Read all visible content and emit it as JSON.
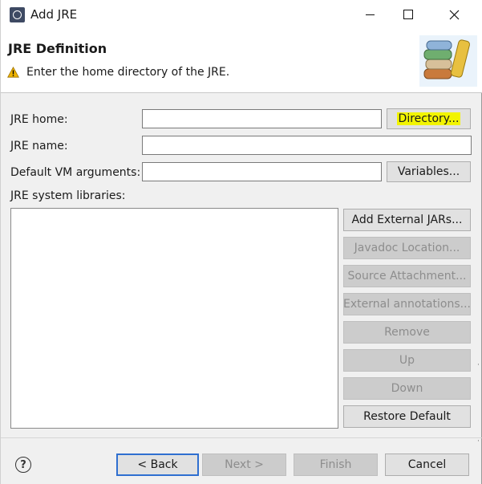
{
  "window": {
    "title": "Add JRE"
  },
  "header": {
    "title": "JRE Definition",
    "description": "Enter the home directory of the JRE."
  },
  "form": {
    "jre_home_label": "JRE home:",
    "jre_home_value": "",
    "directory_button": "Directory...",
    "jre_name_label": "JRE name:",
    "jre_name_value": "",
    "vm_args_label": "Default VM arguments:",
    "vm_args_value": "",
    "variables_button": "Variables...",
    "libraries_label": "JRE system libraries:"
  },
  "library_buttons": [
    {
      "label": "Add External JARs...",
      "enabled": true
    },
    {
      "label": "Javadoc Location...",
      "enabled": false
    },
    {
      "label": "Source Attachment...",
      "enabled": false
    },
    {
      "label": "External annotations...",
      "enabled": false
    },
    {
      "label": "Remove",
      "enabled": false
    },
    {
      "label": "Up",
      "enabled": false
    },
    {
      "label": "Down",
      "enabled": false
    },
    {
      "label": "Restore Default",
      "enabled": true
    }
  ],
  "footer": {
    "back": "< Back",
    "next": "Next >",
    "finish": "Finish",
    "cancel": "Cancel"
  },
  "icons": {
    "app": "eclipse-gear-icon",
    "header_art": "books-icon",
    "warning": "warning-icon",
    "help": "help-icon"
  },
  "colors": {
    "highlight": "#f2f400",
    "default_button_border": "#2f6fd0",
    "warning": "#f0b400"
  }
}
